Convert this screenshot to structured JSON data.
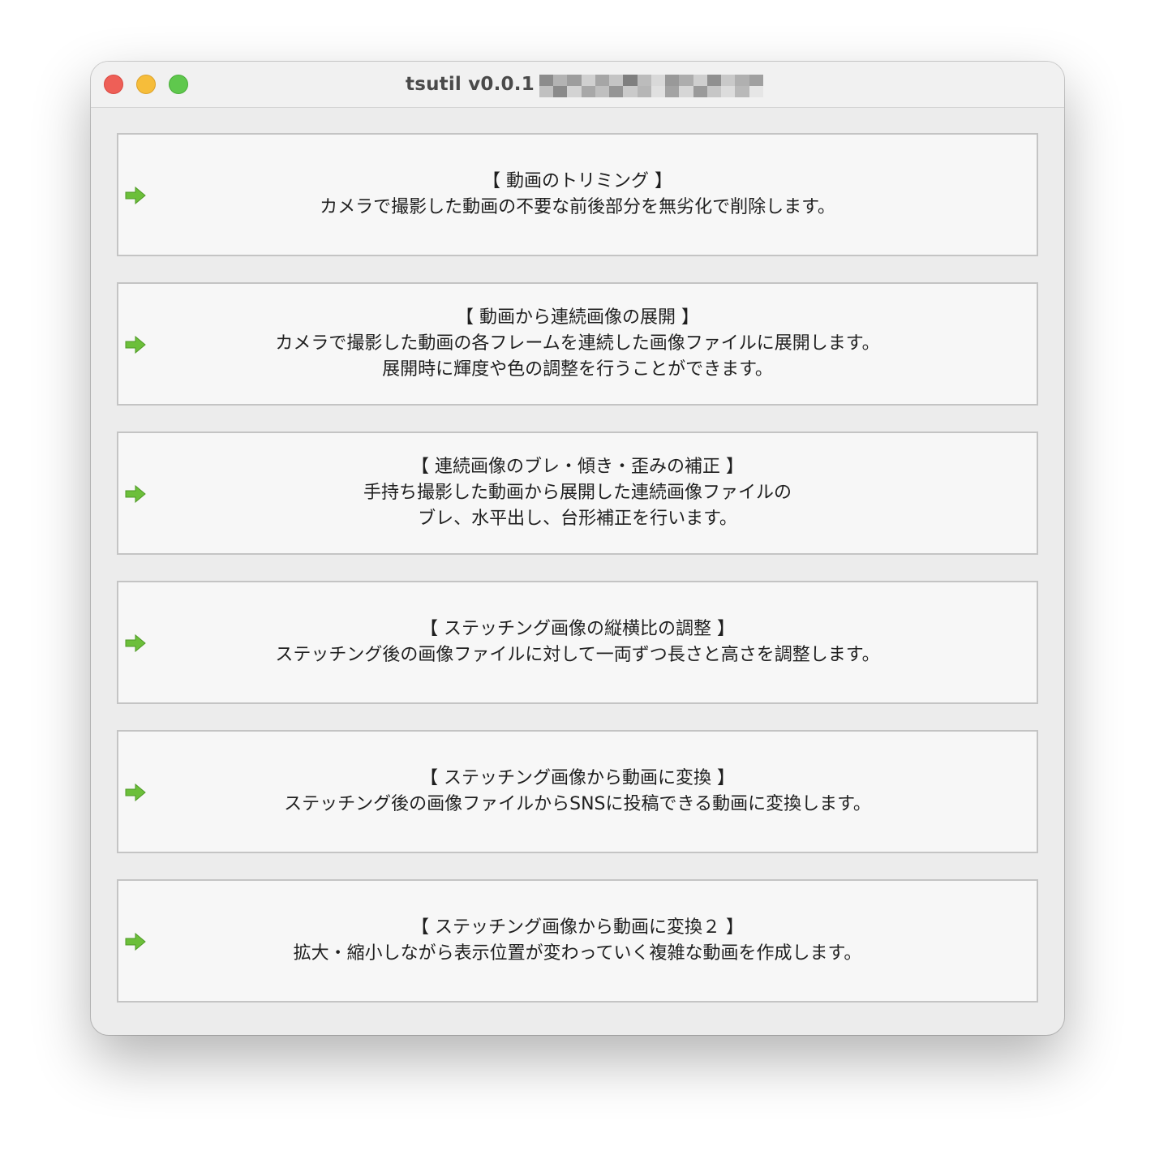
{
  "window": {
    "title": "tsutil v0.0.1",
    "title_redacted": true,
    "traffic_lights": {
      "close_color": "#ee5f57",
      "minimize_color": "#f6bd3a",
      "maximize_color": "#5fc84d"
    }
  },
  "menu": {
    "arrow_icon": "green-right-arrow-icon",
    "arrow_color": "#6cbf3a",
    "items": [
      {
        "heading": "【 動画のトリミング 】",
        "lines": [
          "カメラで撮影した動画の不要な前後部分を無劣化で削除します。"
        ]
      },
      {
        "heading": "【 動画から連続画像の展開 】",
        "lines": [
          "カメラで撮影した動画の各フレームを連続した画像ファイルに展開します。",
          "展開時に輝度や色の調整を行うことができます。"
        ]
      },
      {
        "heading": "【 連続画像のブレ・傾き・歪みの補正 】",
        "lines": [
          "手持ち撮影した動画から展開した連続画像ファイルの",
          "ブレ、水平出し、台形補正を行います。"
        ]
      },
      {
        "heading": "【 ステッチング画像の縦横比の調整 】",
        "lines": [
          "ステッチング後の画像ファイルに対して一両ずつ長さと高さを調整します。"
        ]
      },
      {
        "heading": "【 ステッチング画像から動画に変換 】",
        "lines": [
          "ステッチング後の画像ファイルからSNSに投稿できる動画に変換します。"
        ]
      },
      {
        "heading": "【 ステッチング画像から動画に変換２ 】",
        "lines": [
          "拡大・縮小しながら表示位置が変わっていく複雑な動画を作成します。"
        ]
      }
    ]
  }
}
